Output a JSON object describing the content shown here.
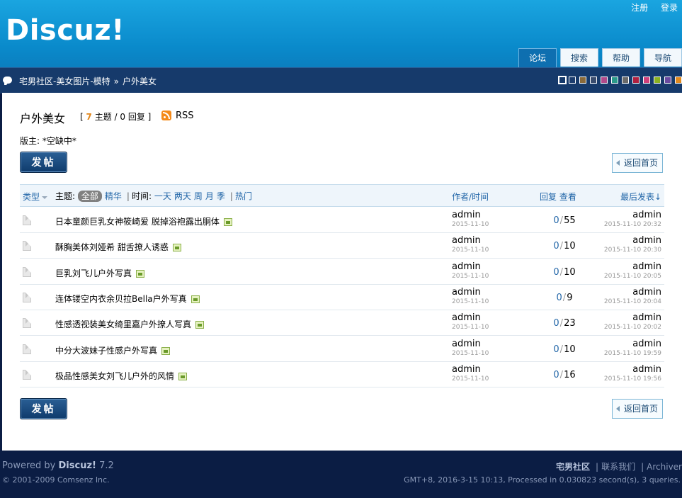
{
  "header": {
    "logo": "Discuz!",
    "topnav": [
      "注册",
      "登录"
    ],
    "tabs": [
      "论坛",
      "搜索",
      "帮助",
      "导航"
    ],
    "active_tab": 0
  },
  "breadcrumb": {
    "path": "宅男社区-美女图片-模特",
    "sep": "»",
    "current": "户外美女"
  },
  "style_swatches": [
    "#ffffff",
    "#1c3d6e",
    "#8a6a3a",
    "#3a4d6e",
    "#b04a8a",
    "#2a9a8a",
    "#6a6a6a",
    "#b02040",
    "#d0407a",
    "#8ab020",
    "#6a4aa0",
    "#e08a20"
  ],
  "forum": {
    "title": "户外美女",
    "stats_open": "[",
    "threads": "7",
    "threads_label": "主题 / 0 回复",
    "stats_close": "]",
    "rss": "RSS",
    "moderator": "版主: *空缺中*",
    "post_button": "发帖",
    "back_button": "返回首页"
  },
  "list_header": {
    "type": "类型",
    "subject_label": "主题:",
    "filter_all": "全部",
    "filter_digest": "精华",
    "time_label": "时间:",
    "time_day": "一天",
    "time_twodays": "两天",
    "time_week": "周",
    "time_month": "月",
    "time_quarter": "季",
    "hot": "热门",
    "author_time": "作者/时间",
    "replies_views": "回复 查看",
    "last_post": "最后发表↓"
  },
  "threads": [
    {
      "title": "日本童颜巨乳女神筱崎爱 脱掉浴袍露出胴体",
      "author": "admin",
      "date": "2015-11-10",
      "replies": "0",
      "views": "55",
      "last_author": "admin",
      "last_date": "2015-11-10 20:32"
    },
    {
      "title": "酥胸美体刘娅希 甜舌撩人诱惑",
      "author": "admin",
      "date": "2015-11-10",
      "replies": "0",
      "views": "10",
      "last_author": "admin",
      "last_date": "2015-11-10 20:30"
    },
    {
      "title": "巨乳刘飞儿户外写真",
      "author": "admin",
      "date": "2015-11-10",
      "replies": "0",
      "views": "10",
      "last_author": "admin",
      "last_date": "2015-11-10 20:05"
    },
    {
      "title": "连体镂空内衣余贝拉Bella户外写真",
      "author": "admin",
      "date": "2015-11-10",
      "replies": "0",
      "views": "9",
      "last_author": "admin",
      "last_date": "2015-11-10 20:04"
    },
    {
      "title": "性感透视装美女绮里嘉户外撩人写真",
      "author": "admin",
      "date": "2015-11-10",
      "replies": "0",
      "views": "23",
      "last_author": "admin",
      "last_date": "2015-11-10 20:02"
    },
    {
      "title": "中分大波妹子性感户外写真",
      "author": "admin",
      "date": "2015-11-10",
      "replies": "0",
      "views": "10",
      "last_author": "admin",
      "last_date": "2015-11-10 19:59"
    },
    {
      "title": "极品性感美女刘飞儿户外的风情",
      "author": "admin",
      "date": "2015-11-10",
      "replies": "0",
      "views": "16",
      "last_author": "admin",
      "last_date": "2015-11-10 19:56"
    }
  ],
  "footer": {
    "powered_prefix": "Powered by",
    "powered_brand": "Discuz!",
    "powered_version": "7.2",
    "copyright": "© 2001-2009 Comsenz Inc.",
    "site_name": "宅男社区",
    "contact": "联系我们",
    "archiver": "Archiver",
    "debug": "GMT+8, 2016-3-15 10:13, Processed in 0.030823 second(s), 3 queries."
  }
}
